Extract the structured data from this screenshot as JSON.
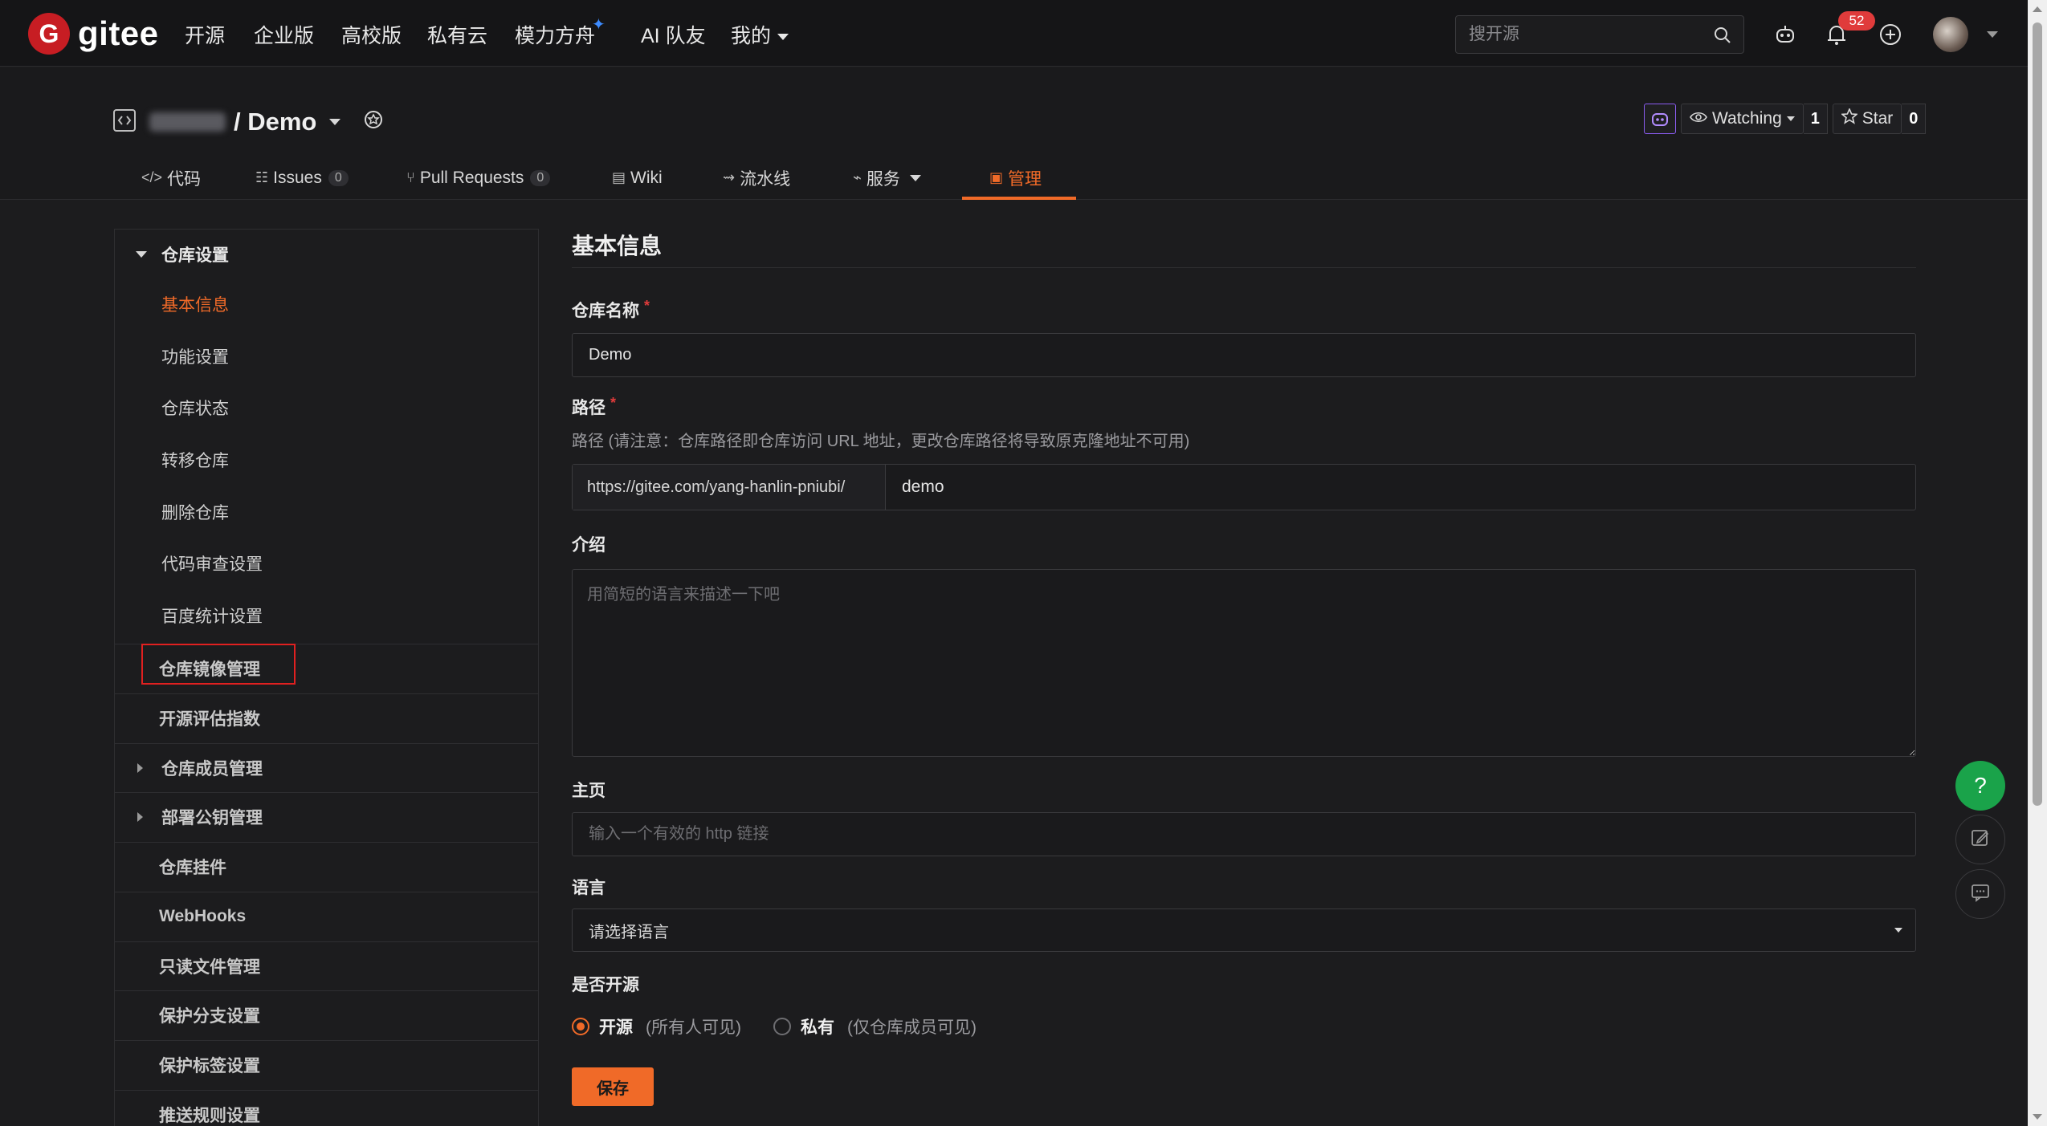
{
  "navbar": {
    "logo_text": "gitee",
    "logo_letter": "G",
    "items": [
      "开源",
      "企业版",
      "高校版",
      "私有云",
      "模力方舟",
      "AI 队友",
      "我的"
    ],
    "search_placeholder": "搜开源",
    "notification_count": "52"
  },
  "repo": {
    "name": "/ Demo",
    "watch_label": "Watching",
    "watch_count": "1",
    "star_label": "Star",
    "star_count": "0"
  },
  "tabs": [
    {
      "label": "代码"
    },
    {
      "label": "Issues",
      "count": "0"
    },
    {
      "label": "Pull Requests",
      "count": "0"
    },
    {
      "label": "Wiki"
    },
    {
      "label": "流水线"
    },
    {
      "label": "服务"
    },
    {
      "label": "管理"
    }
  ],
  "sidebar": {
    "group_title": "仓库设置",
    "sub_items": [
      "基本信息",
      "功能设置",
      "仓库状态",
      "转移仓库",
      "删除仓库",
      "代码审查设置",
      "百度统计设置"
    ],
    "rows": [
      "仓库镜像管理",
      "开源评估指数",
      "仓库成员管理",
      "部署公钥管理",
      "仓库挂件",
      "WebHooks",
      "只读文件管理",
      "保护分支设置",
      "保护标签设置",
      "推送规则设置"
    ]
  },
  "form": {
    "title": "基本信息",
    "name_label": "仓库名称",
    "required_mark": "*",
    "name_value": "Demo",
    "path_label": "路径",
    "path_hint": "路径 (请注意：仓库路径即仓库访问 URL 地址，更改仓库路径将导致原克隆地址不可用)",
    "path_prefix": "https://gitee.com/yang-hanlin-pniubi/",
    "path_value": "demo",
    "intro_label": "介绍",
    "intro_placeholder": "用简短的语言来描述一下吧",
    "homepage_label": "主页",
    "homepage_placeholder": "输入一个有效的 http 链接",
    "language_label": "语言",
    "language_value": "请选择语言",
    "open_label": "是否开源",
    "open_option": "开源",
    "open_note": "(所有人可见)",
    "private_option": "私有",
    "private_note": "(仅仓库成员可见)",
    "save_label": "保存"
  },
  "floating": {
    "help": "?"
  },
  "colors": {
    "accent": "#f06a28",
    "brand_red": "#c71d23",
    "help_green": "#1aa34a",
    "highlight_box": "#e02020"
  },
  "icons": [
    "logo-icon",
    "search-icon",
    "robot-icon",
    "bell-icon",
    "plus-circle-icon",
    "repo-icon",
    "badge-icon",
    "eye-icon",
    "star-icon",
    "code-icon",
    "issues-icon",
    "pull-request-icon",
    "wiki-icon",
    "pipeline-icon",
    "service-icon",
    "manage-icon",
    "edit-icon",
    "chat-icon"
  ]
}
